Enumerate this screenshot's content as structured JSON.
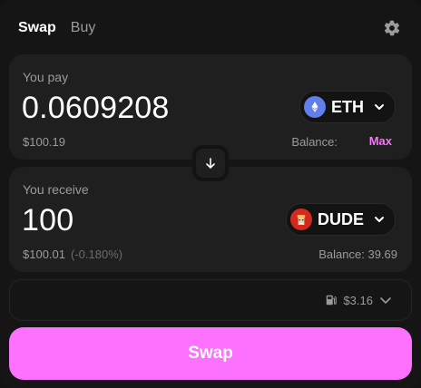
{
  "tabs": [
    {
      "label": "Swap",
      "active": true
    },
    {
      "label": "Buy",
      "active": false
    }
  ],
  "pay": {
    "label": "You pay",
    "amount": "0.0609208",
    "token": {
      "symbol": "ETH",
      "icon": "eth-icon",
      "color": "#627eea"
    },
    "usd": "$100.19",
    "balance_label": "Balance:",
    "max_label": "Max"
  },
  "receive": {
    "label": "You receive",
    "amount": "100",
    "token": {
      "symbol": "DUDE",
      "icon": "dude-token-icon",
      "color": "#d32a1f"
    },
    "usd": "$100.01",
    "price_impact": "(-0.180%)",
    "balance": "Balance: 39.69"
  },
  "fee": {
    "icon": "gas-pump-icon",
    "value": "$3.16"
  },
  "swap_button_label": "Swap",
  "colors": {
    "accent": "#fc72ff",
    "panel": "#1f1f1f",
    "background": "#131313",
    "muted": "#9b9b9b"
  }
}
